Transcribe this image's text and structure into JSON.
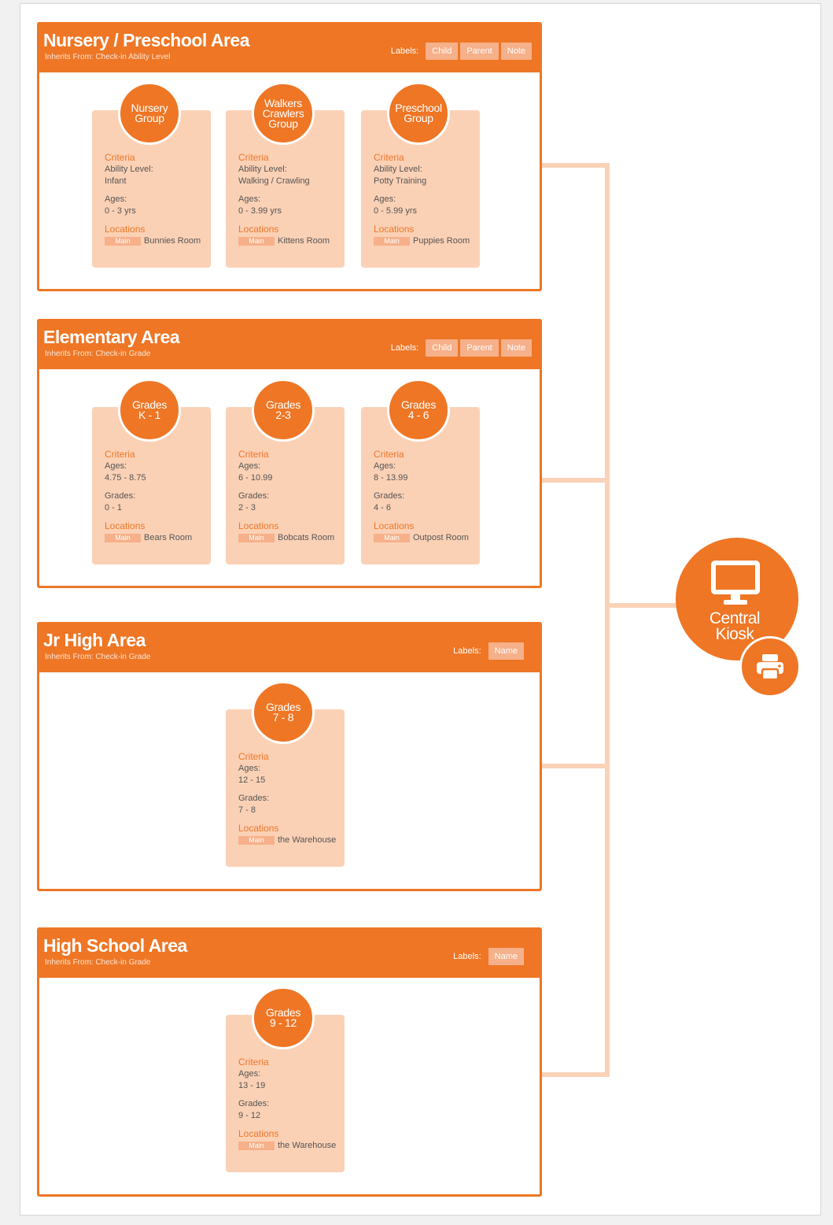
{
  "labels_caption": "Labels:",
  "location_chip": "Main",
  "areas": [
    {
      "title": "Nursery / Preschool Area",
      "inherits": "Inherits From: Check-in Ability Level",
      "labels": [
        "Child",
        "Parent",
        "Note"
      ],
      "groups": [
        {
          "name": "Nursery\nGroup",
          "criteria": "Criteria",
          "field1_label": "Ability Level:",
          "field1_value": "Infant",
          "field2_label": "Ages:",
          "field2_value": "0 - 3 yrs",
          "locations": "Locations",
          "location_name": "Bunnies Room"
        },
        {
          "name": "Walkers\nCrawlers\nGroup",
          "criteria": "Criteria",
          "field1_label": "Ability Level:",
          "field1_value": "Walking / Crawling",
          "field2_label": "Ages:",
          "field2_value": "0 - 3.99 yrs",
          "locations": "Locations",
          "location_name": "Kittens Room"
        },
        {
          "name": "Preschool\nGroup",
          "criteria": "Criteria",
          "field1_label": "Ability Level:",
          "field1_value": "Potty Training",
          "field2_label": "Ages:",
          "field2_value": "0 - 5.99 yrs",
          "locations": "Locations",
          "location_name": "Puppies Room"
        }
      ]
    },
    {
      "title": "Elementary Area",
      "inherits": "Inherits From: Check-in Grade",
      "labels": [
        "Child",
        "Parent",
        "Note"
      ],
      "groups": [
        {
          "name": "Grades\nK - 1",
          "criteria": "Criteria",
          "field1_label": "Ages:",
          "field1_value": "4.75 - 8.75",
          "field2_label": "Grades:",
          "field2_value": "0 - 1",
          "locations": "Locations",
          "location_name": "Bears Room"
        },
        {
          "name": "Grades\n2-3",
          "criteria": "Criteria",
          "field1_label": "Ages:",
          "field1_value": "6 - 10.99",
          "field2_label": "Grades:",
          "field2_value": "2 - 3",
          "locations": "Locations",
          "location_name": "Bobcats Room"
        },
        {
          "name": "Grades\n4 - 6",
          "criteria": "Criteria",
          "field1_label": "Ages:",
          "field1_value": "8 - 13.99",
          "field2_label": "Grades:",
          "field2_value": "4 - 6",
          "locations": "Locations",
          "location_name": "Outpost Room"
        }
      ]
    },
    {
      "title": "Jr High Area",
      "inherits": "Inherits From: Check-in Grade",
      "labels": [
        "Name"
      ],
      "groups": [
        {
          "name": "Grades\n7 - 8",
          "criteria": "Criteria",
          "field1_label": "Ages:",
          "field1_value": "12 - 15",
          "field2_label": "Grades:",
          "field2_value": "7 - 8",
          "locations": "Locations",
          "location_name": "the Warehouse"
        }
      ]
    },
    {
      "title": "High School Area",
      "inherits": "Inherits From: Check-in Grade",
      "labels": [
        "Name"
      ],
      "groups": [
        {
          "name": "Grades\n9 - 12",
          "criteria": "Criteria",
          "field1_label": "Ages:",
          "field1_value": "13 - 19",
          "field2_label": "Grades:",
          "field2_value": "9 - 12",
          "locations": "Locations",
          "location_name": "the Warehouse"
        }
      ]
    }
  ],
  "kiosk": {
    "label": "Central\nKiosk",
    "icon": "monitor-icon",
    "printer_icon": "printer-icon"
  },
  "colors": {
    "accent": "#ee7625",
    "card": "#fbd1b6",
    "chip": "#f6b08a",
    "connector": "#fad2b8"
  }
}
